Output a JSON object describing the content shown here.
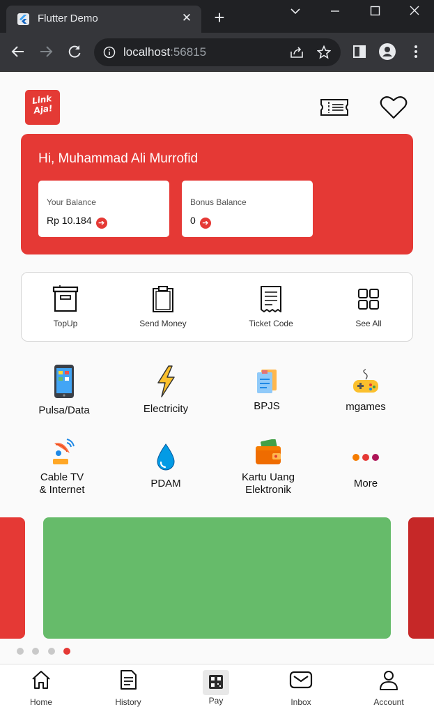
{
  "browser": {
    "tab_title": "Flutter Demo",
    "tab_close": "✕",
    "new_tab": "+",
    "url_host": "localhost",
    "url_port": ":56815"
  },
  "app": {
    "brand_line1": "Link",
    "brand_line2": "Aja!",
    "greeting": "Hi, Muhammad Ali Murrofid",
    "balance": {
      "your_label": "Your Balance",
      "your_value": "Rp 10.184",
      "bonus_label": "Bonus Balance",
      "bonus_value": "0",
      "arrow": "➔"
    },
    "quick_menu": [
      {
        "label": "TopUp",
        "icon": "topup-box-icon"
      },
      {
        "label": "Send Money",
        "icon": "clipboard-icon"
      },
      {
        "label": "Ticket Code",
        "icon": "receipt-icon"
      },
      {
        "label": "See All",
        "icon": "grid-icon"
      }
    ],
    "services": [
      {
        "label": "Pulsa/Data",
        "icon": "phone-icon"
      },
      {
        "label": "Electricity",
        "icon": "lightning-icon"
      },
      {
        "label": "BPJS",
        "icon": "document-icon"
      },
      {
        "label": "mgames",
        "icon": "gamepad-icon"
      },
      {
        "label": "Cable TV\n& Internet",
        "label_l1": "Cable TV",
        "label_l2": "& Internet",
        "icon": "satellite-icon"
      },
      {
        "label": "PDAM",
        "icon": "water-drop-icon"
      },
      {
        "label": "Kartu Uang\nElektronik",
        "label_l1": "Kartu Uang",
        "label_l2": "Elektronik",
        "icon": "wallet-icon"
      },
      {
        "label": "More",
        "icon": "more-dots-icon"
      }
    ],
    "carousel": {
      "slide_colors": [
        "#e53935",
        "#66bb6a",
        "#c62828"
      ],
      "dot_count": 4,
      "active_dot": 4
    },
    "bottom_nav": [
      {
        "label": "Home",
        "icon": "home-icon"
      },
      {
        "label": "History",
        "icon": "history-icon"
      },
      {
        "label": "Pay",
        "icon": "qr-pay-icon"
      },
      {
        "label": "Inbox",
        "icon": "mail-icon"
      },
      {
        "label": "Account",
        "icon": "user-icon"
      }
    ]
  },
  "colors": {
    "primary_red": "#e53935",
    "banner_green": "#66bb6a",
    "chrome_dark": "#202124",
    "chrome_toolbar": "#35363a"
  }
}
